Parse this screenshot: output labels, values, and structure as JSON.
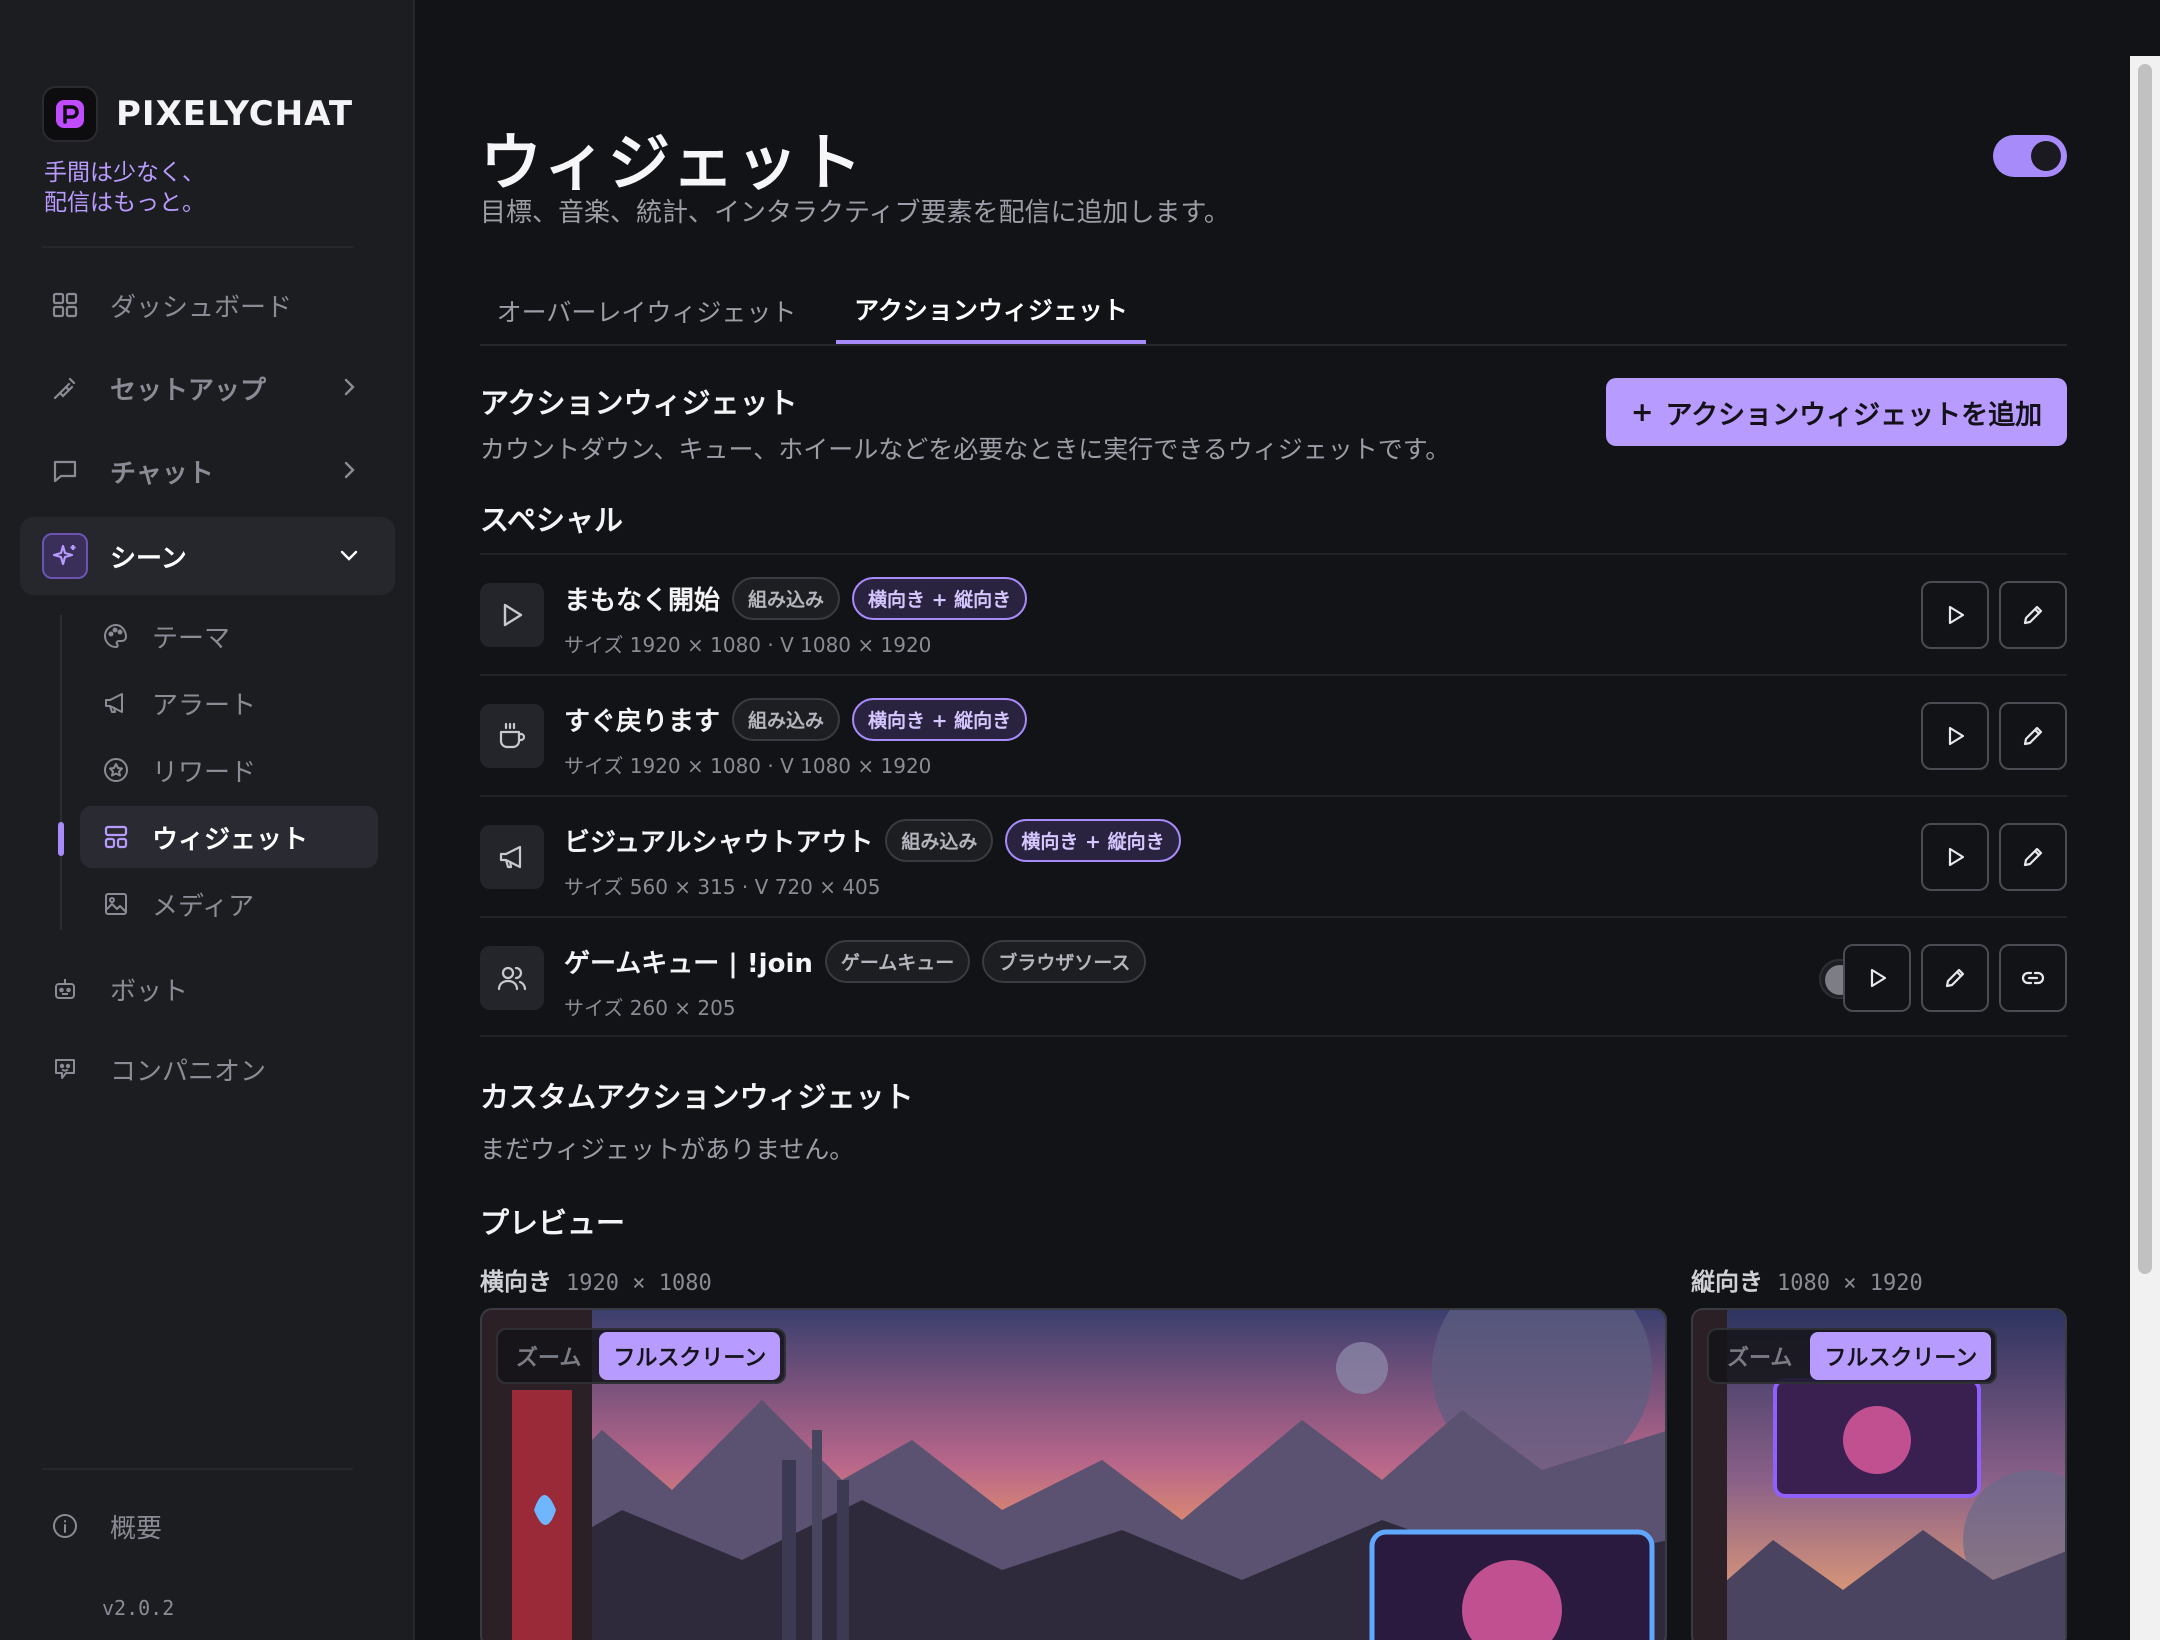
{
  "brand": {
    "name": "PIXELYCHAT",
    "tagline_1": "手間は少なく、",
    "tagline_2": "配信はもっと。"
  },
  "nav": {
    "dashboard": "ダッシュボード",
    "setup": "セットアップ",
    "chat": "チャット",
    "scenes": "シーン",
    "scene_items": {
      "theme": "テーマ",
      "alerts": "アラート",
      "rewards": "リワード",
      "widgets": "ウィジェット",
      "media": "メディア"
    },
    "bot": "ボット",
    "companion": "コンパニオン",
    "about": "概要",
    "version": "v2.0.2"
  },
  "page": {
    "title": "ウィジェット",
    "subtitle": "目標、音楽、統計、インタラクティブ要素を配信に追加します。",
    "enabled": true
  },
  "tabs": {
    "overlay": "オーバーレイウィジェット",
    "action": "アクションウィジェット",
    "active": "action"
  },
  "action_section": {
    "title": "アクションウィジェット",
    "desc": "カウントダウン、キュー、ホイールなどを必要なときに実行できるウィジェットです。",
    "add_button": "アクションウィジェットを追加",
    "add_icon": "+"
  },
  "special": {
    "title": "スペシャル",
    "rows": [
      {
        "icon": "play-icon",
        "title": "まもなく開始",
        "badge1": "組み込み",
        "badge2": "横向き + 縦向き",
        "size": "サイズ 1920 × 1080 · V 1080 × 1920"
      },
      {
        "icon": "coffee-icon",
        "title": "すぐ戻ります",
        "badge1": "組み込み",
        "badge2": "横向き + 縦向き",
        "size": "サイズ 1920 × 1080 · V 1080 × 1920"
      },
      {
        "icon": "megaphone-icon",
        "title": "ビジュアルシャウトアウト",
        "badge1": "組み込み",
        "badge2": "横向き + 縦向き",
        "size": "サイズ 560 × 315 · V 720 × 405"
      },
      {
        "icon": "users-icon",
        "title": "ゲームキュー | !join",
        "badge1": "ゲームキュー",
        "badge2": "ブラウザソース",
        "size": "サイズ 260 × 205",
        "enabled": false
      }
    ]
  },
  "custom": {
    "title": "カスタムアクションウィジェット",
    "empty": "まだウィジェットがありません。"
  },
  "preview": {
    "title": "プレビュー",
    "landscape_label": "横向き",
    "landscape_dim": "1920 × 1080",
    "portrait_label": "縦向き",
    "portrait_dim": "1080 × 1920",
    "zoom": "ズーム",
    "fullscreen": "フルスクリーン"
  },
  "colors": {
    "accent": "#a78bfa",
    "button": "#b79bff",
    "bg": "#121316",
    "sidebar": "#1c1d21"
  }
}
